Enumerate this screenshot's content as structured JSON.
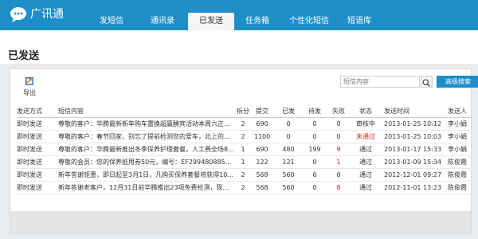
{
  "app": {
    "name": "广讯通",
    "accent": "#1e8ec9"
  },
  "nav": {
    "items": [
      {
        "label": "发短信",
        "width": 64,
        "active": false
      },
      {
        "label": "通讯录",
        "width": 64,
        "active": false
      },
      {
        "label": "已发送",
        "width": 58,
        "active": true
      },
      {
        "label": "任务箱",
        "width": 58,
        "active": false
      },
      {
        "label": "个性化短信",
        "width": 72,
        "active": false
      },
      {
        "label": "短语库",
        "width": 54,
        "active": false
      }
    ]
  },
  "page": {
    "title": "已发送"
  },
  "toolbar": {
    "export_label": "导出",
    "export_icon": "export-icon",
    "search_placeholder": "短信内容",
    "search_icon": "search-icon",
    "advanced_search_label": "高级搜索"
  },
  "table": {
    "headers": [
      "发送方式",
      "短信内容",
      "拆分",
      "提交",
      "已发",
      "待发",
      "失败",
      "状态",
      "发送时间",
      "发送人"
    ],
    "rows": [
      {
        "method": "即时发送",
        "content": "尊敬的客户：华腾最新新年购车置换超赢酬宾活动本周六正式...",
        "split": "2",
        "submitted": "690",
        "sent": "0",
        "pending": "0",
        "failed": "0",
        "failed_red": false,
        "status": "审核中",
        "status_red": false,
        "time": "2013-01-25 10:12",
        "sender": "李小娟"
      },
      {
        "method": "即时发送",
        "content": "尊敬的客户：春节回家，别忘了提前检测您的爱车，北上的朋...",
        "split": "2",
        "submitted": "1100",
        "sent": "0",
        "pending": "0",
        "failed": "0",
        "failed_red": false,
        "status": "未通过",
        "status_red": true,
        "time": "2013-01-25 10:03",
        "sender": "李小娟"
      },
      {
        "method": "即时发送",
        "content": "尊敬的客户：华腾最新推出冬季保养护理套餐，人工费全场8...",
        "split": "1",
        "submitted": "690",
        "sent": "480",
        "pending": "199",
        "failed": "9",
        "failed_red": true,
        "status": "通过",
        "status_red": false,
        "time": "2013-01-17 15:33",
        "sender": "李小娟"
      },
      {
        "method": "即时发送",
        "content": "尊敬的会员：您的保养抵用券50元，编号：EF2994808856...",
        "split": "1",
        "submitted": "122",
        "sent": "121",
        "pending": "0",
        "failed": "1",
        "failed_red": true,
        "status": "通过",
        "status_red": false,
        "time": "2013-01-09 15:34",
        "sender": "陈俊霞"
      },
      {
        "method": "即时发送",
        "content": "新年答谢钜惠，即日起至3月1日，凡购买保养套餐将获得10...",
        "split": "2",
        "submitted": "568",
        "sent": "560",
        "pending": "0",
        "failed": "0",
        "failed_red": false,
        "status": "通过",
        "status_red": false,
        "time": "2012-12-01 09:27",
        "sender": "陈俊霞"
      },
      {
        "method": "即时发送",
        "content": "新年答谢老客户，12月31日前华腾推出23项免费检测，现...",
        "split": "2",
        "submitted": "568",
        "sent": "560",
        "pending": "0",
        "failed": "8",
        "failed_red": true,
        "status": "通过",
        "status_red": false,
        "time": "2012-11-01 13:23",
        "sender": "陈俊霞"
      }
    ]
  }
}
